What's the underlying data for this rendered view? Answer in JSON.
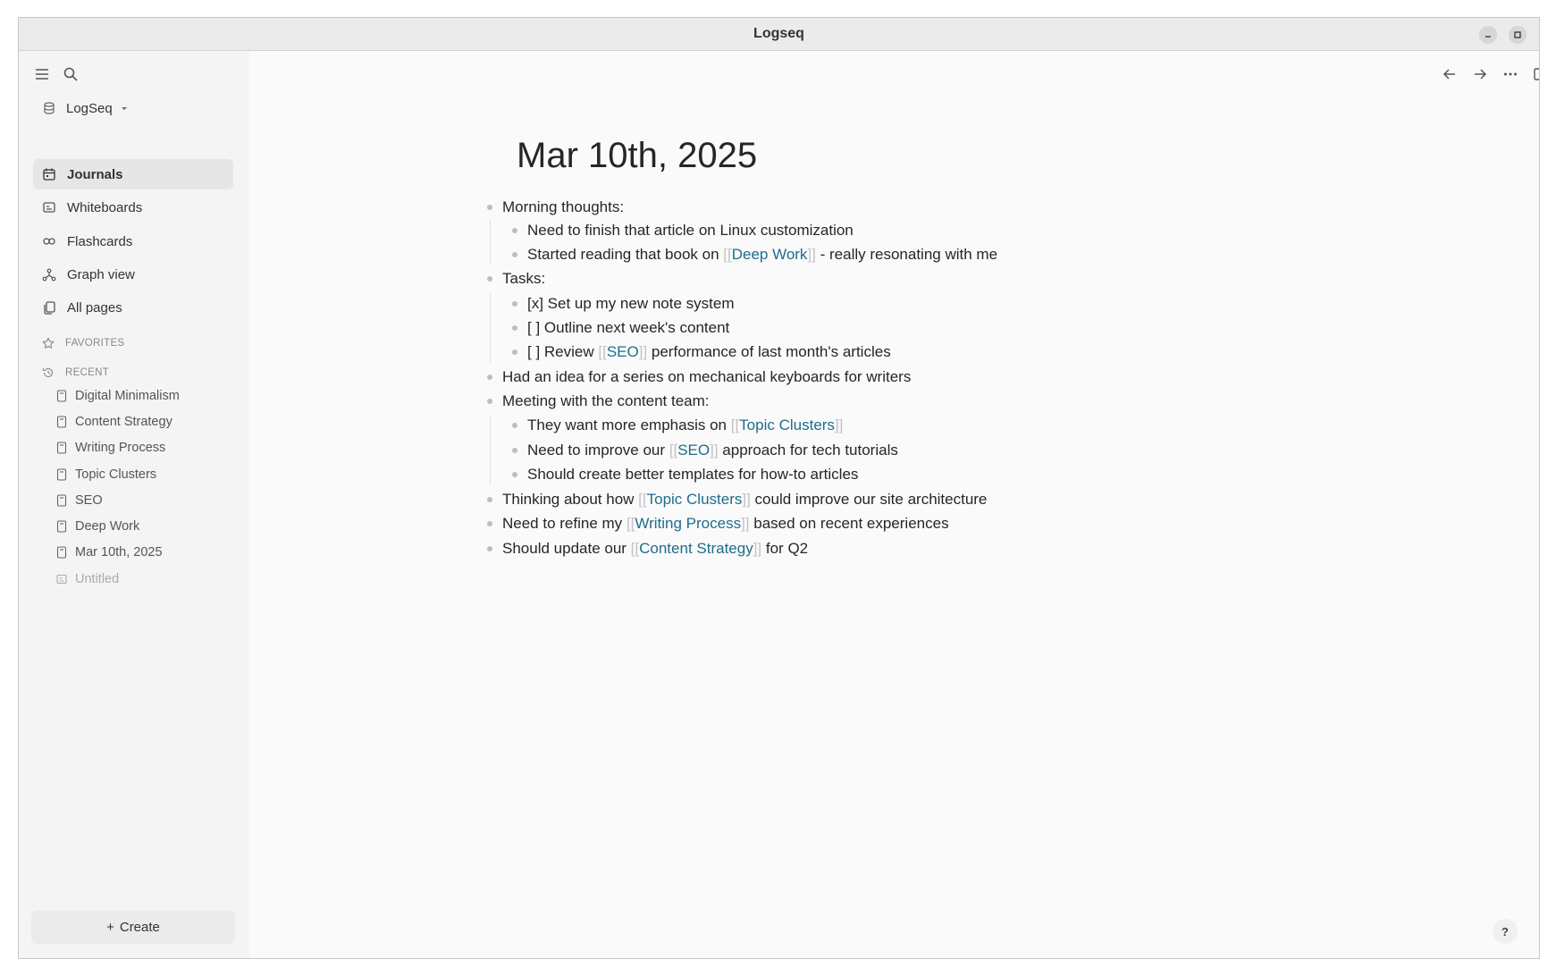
{
  "window": {
    "title": "Logseq"
  },
  "sidebar": {
    "repo": "LogSeq",
    "nav": [
      {
        "label": "Journals",
        "icon": "calendar-icon",
        "active": true
      },
      {
        "label": "Whiteboards",
        "icon": "whiteboard-icon"
      },
      {
        "label": "Flashcards",
        "icon": "infinity-icon"
      },
      {
        "label": "Graph view",
        "icon": "graph-icon"
      },
      {
        "label": "All pages",
        "icon": "pages-icon"
      }
    ],
    "favorites_label": "FAVORITES",
    "recent_label": "RECENT",
    "recent": [
      "Digital Minimalism",
      "Content Strategy",
      "Writing Process",
      "Topic Clusters",
      "SEO",
      "Deep Work",
      "Mar 10th, 2025",
      "Untitled"
    ],
    "create_label": "Create"
  },
  "page": {
    "title": "Mar 10th, 2025",
    "blocks": [
      {
        "level": 0,
        "parts": [
          {
            "t": "Morning thoughts:"
          }
        ]
      },
      {
        "level": 1,
        "parts": [
          {
            "t": "Need to finish that article on Linux customization"
          }
        ]
      },
      {
        "level": 1,
        "parts": [
          {
            "t": "Started reading that book on "
          },
          {
            "ref": "Deep Work"
          },
          {
            "t": " - really resonating with me"
          }
        ]
      },
      {
        "level": 0,
        "parts": [
          {
            "t": "Tasks:"
          }
        ]
      },
      {
        "level": 1,
        "parts": [
          {
            "t": "[x] Set up my new note system"
          }
        ]
      },
      {
        "level": 1,
        "parts": [
          {
            "t": "[ ] Outline next week's content"
          }
        ]
      },
      {
        "level": 1,
        "parts": [
          {
            "t": "[ ] Review "
          },
          {
            "ref": "SEO"
          },
          {
            "t": " performance of last month's articles"
          }
        ]
      },
      {
        "level": 0,
        "parts": [
          {
            "t": "Had an idea for a series on mechanical keyboards for writers"
          }
        ]
      },
      {
        "level": 0,
        "parts": [
          {
            "t": "Meeting with the content team:"
          }
        ]
      },
      {
        "level": 1,
        "parts": [
          {
            "t": "They want more emphasis on "
          },
          {
            "ref": "Topic Clusters"
          }
        ]
      },
      {
        "level": 1,
        "parts": [
          {
            "t": "Need to improve our "
          },
          {
            "ref": "SEO"
          },
          {
            "t": " approach for tech tutorials"
          }
        ]
      },
      {
        "level": 1,
        "parts": [
          {
            "t": "Should create better templates for how-to articles"
          }
        ]
      },
      {
        "level": 0,
        "parts": [
          {
            "t": "Thinking about how "
          },
          {
            "ref": "Topic Clusters"
          },
          {
            "t": " could improve our site architecture"
          }
        ]
      },
      {
        "level": 0,
        "parts": [
          {
            "t": "Need to refine my "
          },
          {
            "ref": "Writing Process"
          },
          {
            "t": " based on recent experiences"
          }
        ]
      },
      {
        "level": 0,
        "parts": [
          {
            "t": "Should update our "
          },
          {
            "ref": "Content Strategy"
          },
          {
            "t": " for Q2"
          }
        ]
      }
    ]
  },
  "help_label": "?"
}
